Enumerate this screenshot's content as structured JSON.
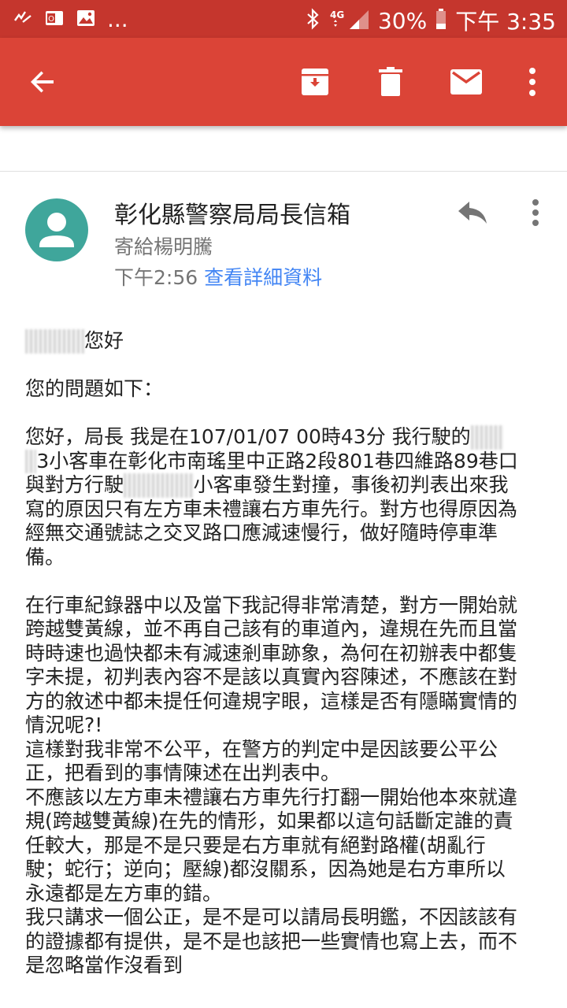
{
  "status_bar": {
    "notification_icons": [
      "missed-call-icon",
      "outlook-icon",
      "image-icon"
    ],
    "more_notifications": "...",
    "network": "4G",
    "battery": "30%",
    "time": "下午 3:35"
  },
  "toolbar": {
    "actions": [
      "back-arrow-icon",
      "archive-icon",
      "trash-icon",
      "mail-icon",
      "more-vert-icon"
    ],
    "accent_color": "#db4437",
    "status_color": "#c5362d"
  },
  "email": {
    "sender": "彰化縣警察局局長信箱",
    "recipient": "寄給楊明騰",
    "time": "下午2:56",
    "details_link": "查看詳細資料",
    "greeting_suffix": "您好",
    "intro": "您的問題如下：",
    "p1_l1_a": "您好，局長 我是在107/01/07 00時43分 我行駛的",
    "p1_l2_b": "3小客車在彰化市南瑤里中正路2段801巷四維路89巷口",
    "p1_l3_a": "與對方行駛",
    "p1_l3_b": "小客車發生對撞，事後初判表出來我",
    "p1_l4": "寫的原因只有左方車未禮讓右方車先行。對方也得原因為",
    "p1_l5": "經無交通號誌之交叉路口應減速慢行，做好隨時停車準",
    "p1_l6": "備。",
    "p2_l1": "在行車紀錄器中以及當下我記得非常清楚，對方一開始就",
    "p2_l2": "跨越雙黃線，並不再自己該有的車道內，違規在先而且當",
    "p2_l3": "時時速也過快都未有減速剎車跡象，為何在初辦表中都隻",
    "p2_l4": "字未提，初判表內容不是該以真實內容陳述，不應該在對",
    "p2_l5": "方的敘述中都未提任何違規字眼，這樣是否有隱瞞實情的",
    "p2_l6": "情況呢?!",
    "p3_l1": "這樣對我非常不公平，在警方的判定中是因該要公平公",
    "p3_l2": "正，把看到的事情陳述在出判表中。",
    "p4_l1": "不應該以左方車未禮讓右方車先行打翻一開始他本來就違",
    "p4_l2": "規(跨越雙黃線)在先的情形，如果都以這句話斷定誰的責",
    "p4_l3": "任較大，那是不是只要是右方車就有絕對路權(胡亂行",
    "p4_l4": "駛；蛇行；逆向；壓線)都沒關系，因為她是右方車所以",
    "p4_l5": "永遠都是左方車的錯。",
    "p5_l1": "我只講求一個公正，是不是可以請局長明鑑，不因該該有",
    "p5_l2": "的證據都有提供，是不是也該把一些實情也寫上去，而不",
    "p5_l3": "是忽略當作沒看到"
  }
}
